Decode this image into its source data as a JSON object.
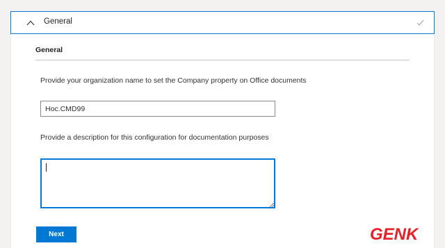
{
  "accordion": {
    "title": "General",
    "expanded": true,
    "completed": true
  },
  "section": {
    "title": "General"
  },
  "company": {
    "label": "Provide your organization name to set the Company property on Office documents",
    "value": "Hoc.CMD99"
  },
  "description": {
    "label": "Provide a description for this configuration for documentation purposes",
    "value": ""
  },
  "actions": {
    "next_label": "Next"
  },
  "watermark": {
    "text": "GENK"
  },
  "colors": {
    "accent": "#0078d4",
    "watermark_red": "#e8202a"
  },
  "icons": {
    "collapse": "chevron-up-icon",
    "status": "checkmark-icon"
  }
}
